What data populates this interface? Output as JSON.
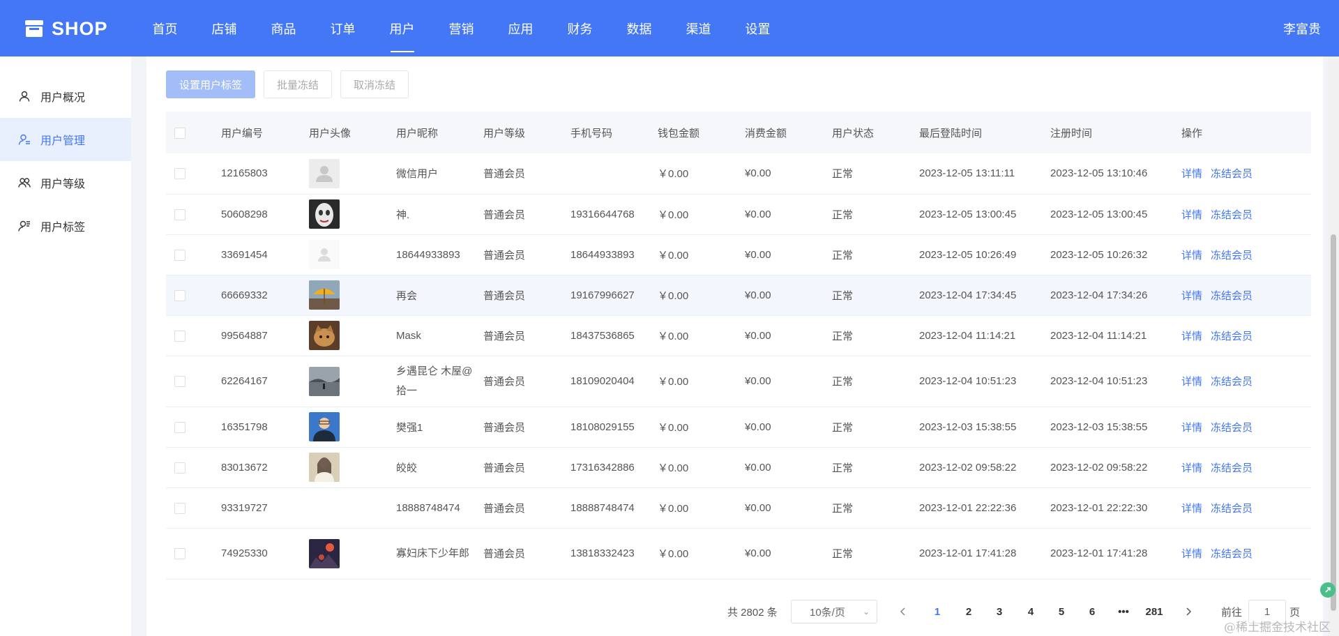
{
  "header": {
    "logo_text": "SHOP",
    "nav": [
      {
        "label": "首页"
      },
      {
        "label": "店铺"
      },
      {
        "label": "商品"
      },
      {
        "label": "订单"
      },
      {
        "label": "用户",
        "active": true
      },
      {
        "label": "营销"
      },
      {
        "label": "应用"
      },
      {
        "label": "财务"
      },
      {
        "label": "数据"
      },
      {
        "label": "渠道"
      },
      {
        "label": "设置"
      }
    ],
    "user_name": "李富贵",
    "bg_color": "#4477f5"
  },
  "sidebar": {
    "items": [
      {
        "label": "用户概况",
        "icon": "user-icon"
      },
      {
        "label": "用户管理",
        "icon": "user-manage-icon",
        "active": true
      },
      {
        "label": "用户等级",
        "icon": "users-icon"
      },
      {
        "label": "用户标签",
        "icon": "user-tag-icon"
      }
    ]
  },
  "toolbar": {
    "set_tag_label": "设置用户标签",
    "batch_freeze_label": "批量冻结",
    "cancel_freeze_label": "取消冻结"
  },
  "table": {
    "columns": [
      "用户编号",
      "用户头像",
      "用户昵称",
      "用户等级",
      "手机号码",
      "钱包金额",
      "消费金额",
      "用户状态",
      "最后登陆时间",
      "注册时间",
      "操作"
    ],
    "actions": {
      "detail": "详情",
      "freeze": "冻结会员"
    },
    "rows": [
      {
        "id": "12165803",
        "avatar": "default-gray",
        "nickname": "微信用户",
        "level": "普通会员",
        "phone": "",
        "wallet": "￥0.00",
        "spend": "¥0.00",
        "status": "正常",
        "last_login": "2023-12-05 13:11:11",
        "registered": "2023-12-05 13:10:46"
      },
      {
        "id": "50608298",
        "avatar": "mask-face",
        "nickname": "神.",
        "level": "普通会员",
        "phone": "19316644768",
        "wallet": "￥0.00",
        "spend": "¥0.00",
        "status": "正常",
        "last_login": "2023-12-05 13:00:45",
        "registered": "2023-12-05 13:00:45"
      },
      {
        "id": "33691454",
        "avatar": "default-white",
        "nickname": "18644933893",
        "level": "普通会员",
        "phone": "18644933893",
        "wallet": "￥0.00",
        "spend": "¥0.00",
        "status": "正常",
        "last_login": "2023-12-05 10:26:49",
        "registered": "2023-12-05 10:26:32"
      },
      {
        "id": "66669332",
        "avatar": "umbrella",
        "nickname": "再会",
        "level": "普通会员",
        "phone": "19167996627",
        "wallet": "￥0.00",
        "spend": "¥0.00",
        "status": "正常",
        "last_login": "2023-12-04 17:34:45",
        "registered": "2023-12-04 17:34:26"
      },
      {
        "id": "99564887",
        "avatar": "cat",
        "nickname": "Mask",
        "level": "普通会员",
        "phone": "18437536865",
        "wallet": "￥0.00",
        "spend": "¥0.00",
        "status": "正常",
        "last_login": "2023-12-04 11:14:21",
        "registered": "2023-12-04 11:14:21"
      },
      {
        "id": "62264167",
        "avatar": "landscape",
        "nickname": "乡遇昆仑 木屋@拾一",
        "level": "普通会员",
        "phone": "18109020404",
        "wallet": "￥0.00",
        "spend": "¥0.00",
        "status": "正常",
        "last_login": "2023-12-04 10:51:23",
        "registered": "2023-12-04 10:51:23"
      },
      {
        "id": "16351798",
        "avatar": "man-portrait",
        "nickname": "樊强1",
        "level": "普通会员",
        "phone": "18108029155",
        "wallet": "￥0.00",
        "spend": "¥0.00",
        "status": "正常",
        "last_login": "2023-12-03 15:38:55",
        "registered": "2023-12-03 15:38:55"
      },
      {
        "id": "83013672",
        "avatar": "girl-portrait",
        "nickname": "皎皎",
        "level": "普通会员",
        "phone": "17316342886",
        "wallet": "￥0.00",
        "spend": "¥0.00",
        "status": "正常",
        "last_login": "2023-12-02 09:58:22",
        "registered": "2023-12-02 09:58:22"
      },
      {
        "id": "93319727",
        "avatar": "",
        "nickname": "18888748474",
        "level": "普通会员",
        "phone": "18888748474",
        "wallet": "￥0.00",
        "spend": "¥0.00",
        "status": "正常",
        "last_login": "2023-12-01 22:22:36",
        "registered": "2023-12-01 22:22:30"
      },
      {
        "id": "74925330",
        "avatar": "dark-scene",
        "nickname": "寡妇床下少年郎",
        "level": "普通会员",
        "phone": "13818332423",
        "wallet": "￥0.00",
        "spend": "¥0.00",
        "status": "正常",
        "last_login": "2023-12-01 17:41:28",
        "registered": "2023-12-01 17:41:28"
      }
    ]
  },
  "pagination": {
    "total_text": "共 2802 条",
    "page_size": "10条/页",
    "pages": [
      "1",
      "2",
      "3",
      "4",
      "5",
      "6",
      "•••",
      "281"
    ],
    "current": "1",
    "goto_label": "前往",
    "goto_value": "1",
    "page_suffix": "页"
  },
  "watermark": "@稀土掘金技术社区"
}
